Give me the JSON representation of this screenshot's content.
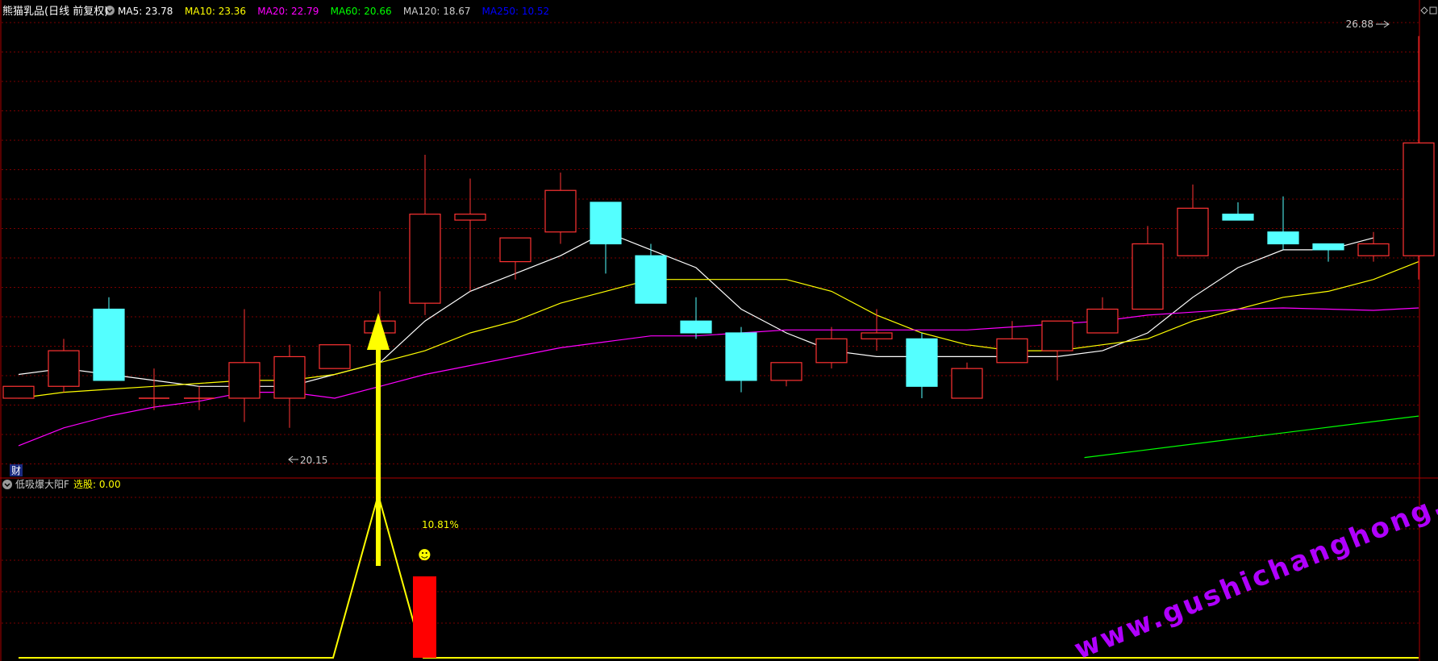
{
  "header": {
    "stock_name": "熊猫乳品(日线 前复权)",
    "ma_items": [
      {
        "label": "MA5: 23.78",
        "color": "#ffffff"
      },
      {
        "label": "MA10: 23.36",
        "color": "#ffff00"
      },
      {
        "label": "MA20: 22.79",
        "color": "#ff00ff"
      },
      {
        "label": "MA60: 20.66",
        "color": "#00ff00"
      },
      {
        "label": "MA120: 18.67",
        "color": "#cccccc"
      },
      {
        "label": "MA250: 10.52",
        "color": "#0000ff"
      }
    ]
  },
  "indicator_header": {
    "name": "低吸爆大阳F",
    "value_label": "选股: 0.00"
  },
  "annotations": {
    "high_label": "26.88",
    "low_label": "20.15",
    "cai_badge": "财",
    "pct_label": "10.81%",
    "smiley": "☻",
    "watermark": "www.gushichanghong.com"
  },
  "colors": {
    "up": "#ff3333",
    "down": "#54ffff",
    "grid": "#7a0000",
    "frame": "#b00000",
    "ma5": "#ffffff",
    "ma10": "#ffff00",
    "ma20": "#ff00ff",
    "ma60": "#00ff00",
    "signal": "#ffff00",
    "signal_bar": "#ff0000",
    "watermark": "#b000ff"
  },
  "chart_data": {
    "type": "candlestick",
    "ylim": [
      19.7,
      27.1
    ],
    "candles": [
      {
        "o": 20.8,
        "c": 21.0,
        "h": 21.0,
        "l": 20.8
      },
      {
        "o": 21.0,
        "c": 21.6,
        "h": 21.8,
        "l": 20.9
      },
      {
        "o": 22.3,
        "c": 21.1,
        "h": 22.5,
        "l": 21.1
      },
      {
        "o": 20.8,
        "c": 20.8,
        "h": 21.3,
        "l": 20.6
      },
      {
        "o": 20.8,
        "c": 20.8,
        "h": 21.0,
        "l": 20.6
      },
      {
        "o": 20.8,
        "c": 21.4,
        "h": 22.3,
        "l": 20.4
      },
      {
        "o": 20.8,
        "c": 21.5,
        "h": 21.7,
        "l": 20.3
      },
      {
        "o": 21.3,
        "c": 21.7,
        "h": 21.7,
        "l": 21.3
      },
      {
        "o": 21.9,
        "c": 22.1,
        "h": 22.6,
        "l": 21.9
      },
      {
        "o": 22.4,
        "c": 23.9,
        "h": 24.9,
        "l": 22.2
      },
      {
        "o": 23.8,
        "c": 23.9,
        "h": 24.5,
        "l": 22.6
      },
      {
        "o": 23.1,
        "c": 23.5,
        "h": 23.5,
        "l": 22.8
      },
      {
        "o": 23.6,
        "c": 24.3,
        "h": 24.6,
        "l": 23.4
      },
      {
        "o": 24.1,
        "c": 23.4,
        "h": 24.1,
        "l": 22.9
      },
      {
        "o": 23.2,
        "c": 22.4,
        "h": 23.4,
        "l": 22.4
      },
      {
        "o": 22.1,
        "c": 21.9,
        "h": 22.5,
        "l": 21.8
      },
      {
        "o": 21.9,
        "c": 21.1,
        "h": 22.0,
        "l": 20.9
      },
      {
        "o": 21.1,
        "c": 21.4,
        "h": 21.4,
        "l": 21.0
      },
      {
        "o": 21.4,
        "c": 21.8,
        "h": 22.0,
        "l": 21.3
      },
      {
        "o": 21.8,
        "c": 21.9,
        "h": 22.3,
        "l": 21.6
      },
      {
        "o": 21.8,
        "c": 21.0,
        "h": 21.9,
        "l": 20.8
      },
      {
        "o": 20.8,
        "c": 21.3,
        "h": 21.4,
        "l": 20.8
      },
      {
        "o": 21.4,
        "c": 21.8,
        "h": 22.1,
        "l": 21.4
      },
      {
        "o": 21.6,
        "c": 22.1,
        "h": 22.1,
        "l": 21.1
      },
      {
        "o": 21.9,
        "c": 22.3,
        "h": 22.5,
        "l": 21.9
      },
      {
        "o": 22.3,
        "c": 23.4,
        "h": 23.7,
        "l": 22.3
      },
      {
        "o": 23.2,
        "c": 24.0,
        "h": 24.4,
        "l": 23.2
      },
      {
        "o": 23.9,
        "c": 23.8,
        "h": 24.1,
        "l": 23.8
      },
      {
        "o": 23.6,
        "c": 23.4,
        "h": 24.2,
        "l": 23.3
      },
      {
        "o": 23.4,
        "c": 23.3,
        "h": 23.4,
        "l": 23.1
      },
      {
        "o": 23.2,
        "c": 23.4,
        "h": 23.6,
        "l": 23.1
      },
      {
        "o": 23.2,
        "c": 25.1,
        "h": 26.9,
        "l": 22.8
      }
    ],
    "series": [
      {
        "values": [
          21.2,
          21.3,
          21.2,
          21.1,
          21.0,
          21.0,
          21.0,
          21.2,
          21.4,
          22.1,
          22.6,
          22.9,
          23.2,
          23.6,
          23.3,
          23.0,
          22.3,
          21.9,
          21.6,
          21.5,
          21.5,
          21.5,
          21.5,
          21.5,
          21.6,
          21.9,
          22.5,
          23.0,
          23.3,
          23.3,
          23.5
        ]
      },
      {
        "values": [
          20.8,
          20.9,
          20.95,
          21.0,
          21.05,
          21.1,
          21.1,
          21.2,
          21.4,
          21.6,
          21.9,
          22.1,
          22.4,
          22.6,
          22.8,
          22.8,
          22.8,
          22.8,
          22.6,
          22.2,
          21.9,
          21.7,
          21.6,
          21.6,
          21.7,
          21.8,
          22.1,
          22.3,
          22.5,
          22.6,
          22.8,
          23.1
        ]
      },
      {
        "values": [
          20.0,
          20.3,
          20.5,
          20.65,
          20.75,
          20.9,
          20.9,
          20.8,
          21.0,
          21.2,
          21.35,
          21.5,
          21.65,
          21.75,
          21.85,
          21.85,
          21.9,
          21.95,
          21.95,
          21.95,
          21.95,
          21.95,
          22.0,
          22.05,
          22.1,
          22.2,
          22.25,
          22.3,
          22.32,
          22.3,
          22.28,
          22.32
        ]
      },
      {
        "values": [
          19.8,
          19.9,
          20.0,
          20.1,
          20.2,
          20.3,
          20.4,
          20.5
        ]
      }
    ],
    "signal": {
      "x": [
        0,
        1,
        2,
        3,
        4,
        5,
        6,
        7,
        8,
        9,
        10
      ],
      "values": [
        0,
        0,
        0,
        0,
        0,
        0,
        0,
        0,
        1,
        0,
        0
      ],
      "bar_index": 9,
      "bar_value": 1
    }
  }
}
